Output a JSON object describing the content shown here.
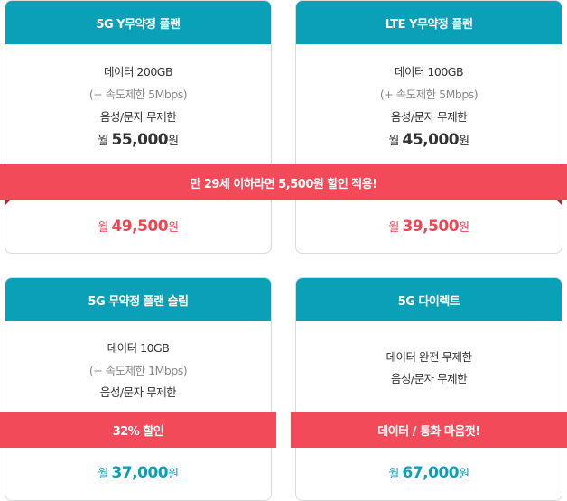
{
  "plans": [
    {
      "title": "5G Y무약정 플랜",
      "lines": [
        "데이터 200GB",
        "(+ 속도제한 5Mbps)",
        "음성/문자 무제한"
      ],
      "price": {
        "prefix": "월 ",
        "amount": "55,000",
        "suffix": "원"
      },
      "discount_price": {
        "prefix": "월 ",
        "amount": "49,500",
        "suffix": "원"
      }
    },
    {
      "title": "LTE Y무약정 플랜",
      "lines": [
        "데이터 100GB",
        "(+ 속도제한 5Mbps)",
        "음성/문자 무제한"
      ],
      "price": {
        "prefix": "월 ",
        "amount": "45,000",
        "suffix": "원"
      },
      "discount_price": {
        "prefix": "월 ",
        "amount": "39,500",
        "suffix": "원"
      }
    },
    {
      "title": "5G 무약정 플랜 슬림",
      "lines": [
        "데이터 10GB",
        "(+ 속도제한 1Mbps)",
        "음성/문자 무제한"
      ],
      "price": {
        "prefix": "월 ",
        "amount": "37,000",
        "suffix": "원"
      }
    },
    {
      "title": "5G 다이렉트",
      "lines": [
        "데이터 완전 무제한",
        "음성/문자 무제한"
      ],
      "price": {
        "prefix": "월 ",
        "amount": "67,000",
        "suffix": "원"
      }
    }
  ],
  "banners": {
    "youth": "만 29세 이하라면 5,500원 할인 적용!",
    "slim": "32% 할인",
    "direct": "데이터 / 통화 마음껏!"
  },
  "colors": {
    "header": "#0aa1b8",
    "banner": "#f34a5a",
    "discount_price": "#ef4452"
  }
}
